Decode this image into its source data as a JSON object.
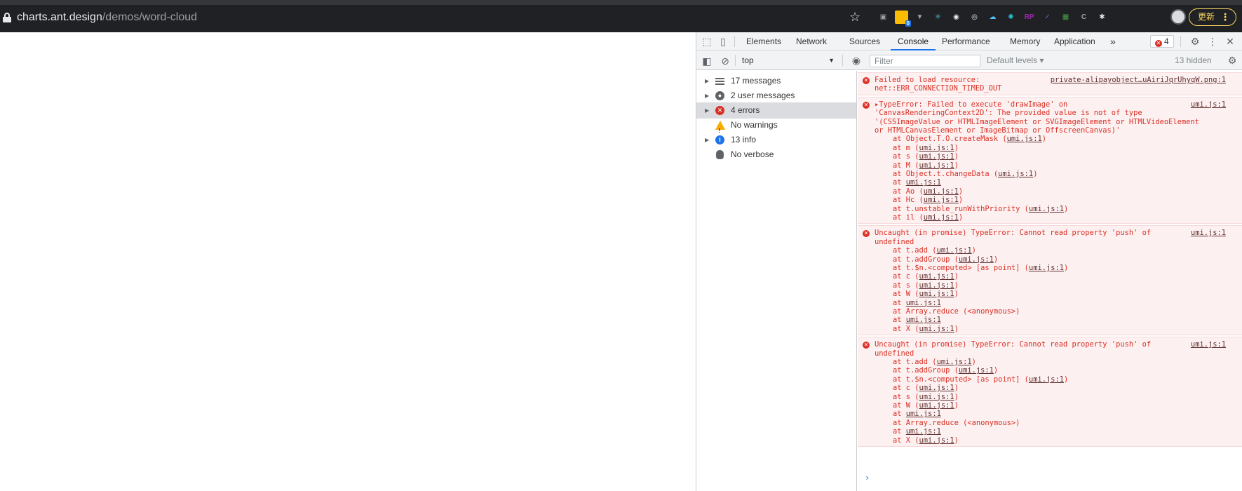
{
  "browser": {
    "url_domain": "charts.ant.design",
    "url_path": "/demos/word-cloud",
    "update_label": "更新",
    "extensions": [
      {
        "name": "camera-icon",
        "color": "#9aa0a6",
        "text": "▣"
      },
      {
        "name": "notes-extension-icon",
        "color": "#fbbc04",
        "text": "",
        "badge": "0"
      },
      {
        "name": "vue-devtools-icon",
        "color": "#9aa0a6",
        "text": "▼"
      },
      {
        "name": "react-devtools-icon",
        "color": "#61dafb",
        "text": "⚛"
      },
      {
        "name": "eye-extension-icon",
        "color": "#e8eaed",
        "text": "◉"
      },
      {
        "name": "target-extension-icon",
        "color": "#e8eaed",
        "text": "◎"
      },
      {
        "name": "cloud-extension-icon",
        "color": "#4fc3f7",
        "text": "☁"
      },
      {
        "name": "teal-extension-icon",
        "color": "#26c6da",
        "text": "✺"
      },
      {
        "name": "rp-extension-icon",
        "color": "#9c27b0",
        "text": "RP"
      },
      {
        "name": "check-extension-icon",
        "color": "#5c6bc0",
        "text": "✓"
      },
      {
        "name": "grid-extension-icon",
        "color": "#43a047",
        "text": "▦"
      },
      {
        "name": "bracket-extension-icon",
        "color": "#9aa0a6",
        "text": "C"
      },
      {
        "name": "puzzle-icon",
        "color": "#e8eaed",
        "text": "✱"
      }
    ]
  },
  "devtools": {
    "tabs": [
      "Elements",
      "Network",
      "Sources",
      "Console",
      "Performance",
      "Memory",
      "Application"
    ],
    "more_tabs": "»",
    "error_count": "4",
    "context": "top",
    "filter_placeholder": "Filter",
    "levels": "Default levels ▾",
    "hidden": "13 hidden",
    "sidebar": [
      {
        "label": "17 messages",
        "icon": "list-icon",
        "expandable": true
      },
      {
        "label": "2 user messages",
        "icon": "user-icon",
        "expandable": true
      },
      {
        "label": "4 errors",
        "icon": "error-icon",
        "expandable": true,
        "selected": true
      },
      {
        "label": "No warnings",
        "icon": "warning-icon",
        "expandable": false
      },
      {
        "label": "13 info",
        "icon": "info-icon",
        "expandable": true
      },
      {
        "label": "No verbose",
        "icon": "bug-icon",
        "expandable": false
      }
    ],
    "messages": [
      {
        "text": "Failed to load resource:\nnet::ERR_CONNECTION_TIMED_OUT",
        "source": "private-alipayobject…uAiriJqrUhyqW.png:1",
        "stack": []
      },
      {
        "text": "▸TypeError: Failed to execute 'drawImage' on\n'CanvasRenderingContext2D': The provided value is not of type\n'(CSSImageValue or HTMLImageElement or SVGImageElement or HTMLVideoElement\nor HTMLCanvasElement or ImageBitmap or OffscreenCanvas)'",
        "source": "umi.js:1",
        "stack": [
          {
            "pre": "at Object.T.O.createMask (",
            "link": "umi.js:1",
            "post": ")"
          },
          {
            "pre": "at m (",
            "link": "umi.js:1",
            "post": ")"
          },
          {
            "pre": "at s (",
            "link": "umi.js:1",
            "post": ")"
          },
          {
            "pre": "at M (",
            "link": "umi.js:1",
            "post": ")"
          },
          {
            "pre": "at Object.t.changeData (",
            "link": "umi.js:1",
            "post": ")"
          },
          {
            "pre": "at ",
            "link": "umi.js:1",
            "post": ""
          },
          {
            "pre": "at Ao (",
            "link": "umi.js:1",
            "post": ")"
          },
          {
            "pre": "at Hc (",
            "link": "umi.js:1",
            "post": ")"
          },
          {
            "pre": "at t.unstable_runWithPriority (",
            "link": "umi.js:1",
            "post": ")"
          },
          {
            "pre": "at il (",
            "link": "umi.js:1",
            "post": ")"
          }
        ]
      },
      {
        "text": "Uncaught (in promise) TypeError: Cannot read property 'push' of\nundefined",
        "source": "umi.js:1",
        "stack": [
          {
            "pre": "at t.add (",
            "link": "umi.js:1",
            "post": ")"
          },
          {
            "pre": "at t.addGroup (",
            "link": "umi.js:1",
            "post": ")"
          },
          {
            "pre": "at t.$n.<computed> [as point] (",
            "link": "umi.js:1",
            "post": ")"
          },
          {
            "pre": "at c (",
            "link": "umi.js:1",
            "post": ")"
          },
          {
            "pre": "at s (",
            "link": "umi.js:1",
            "post": ")"
          },
          {
            "pre": "at W (",
            "link": "umi.js:1",
            "post": ")"
          },
          {
            "pre": "at ",
            "link": "umi.js:1",
            "post": ""
          },
          {
            "pre": "at Array.reduce (<anonymous>)",
            "link": "",
            "post": ""
          },
          {
            "pre": "at ",
            "link": "umi.js:1",
            "post": ""
          },
          {
            "pre": "at X (",
            "link": "umi.js:1",
            "post": ")"
          }
        ]
      },
      {
        "text": "Uncaught (in promise) TypeError: Cannot read property 'push' of\nundefined",
        "source": "umi.js:1",
        "stack": [
          {
            "pre": "at t.add (",
            "link": "umi.js:1",
            "post": ")"
          },
          {
            "pre": "at t.addGroup (",
            "link": "umi.js:1",
            "post": ")"
          },
          {
            "pre": "at t.$n.<computed> [as point] (",
            "link": "umi.js:1",
            "post": ")"
          },
          {
            "pre": "at c (",
            "link": "umi.js:1",
            "post": ")"
          },
          {
            "pre": "at s (",
            "link": "umi.js:1",
            "post": ")"
          },
          {
            "pre": "at W (",
            "link": "umi.js:1",
            "post": ")"
          },
          {
            "pre": "at ",
            "link": "umi.js:1",
            "post": ""
          },
          {
            "pre": "at Array.reduce (<anonymous>)",
            "link": "",
            "post": ""
          },
          {
            "pre": "at ",
            "link": "umi.js:1",
            "post": ""
          },
          {
            "pre": "at X (",
            "link": "umi.js:1",
            "post": ")"
          }
        ]
      }
    ],
    "prompt": "›"
  },
  "colors": {
    "error": "#d93025",
    "accent": "#1a73e8",
    "update": "#fdd663"
  }
}
